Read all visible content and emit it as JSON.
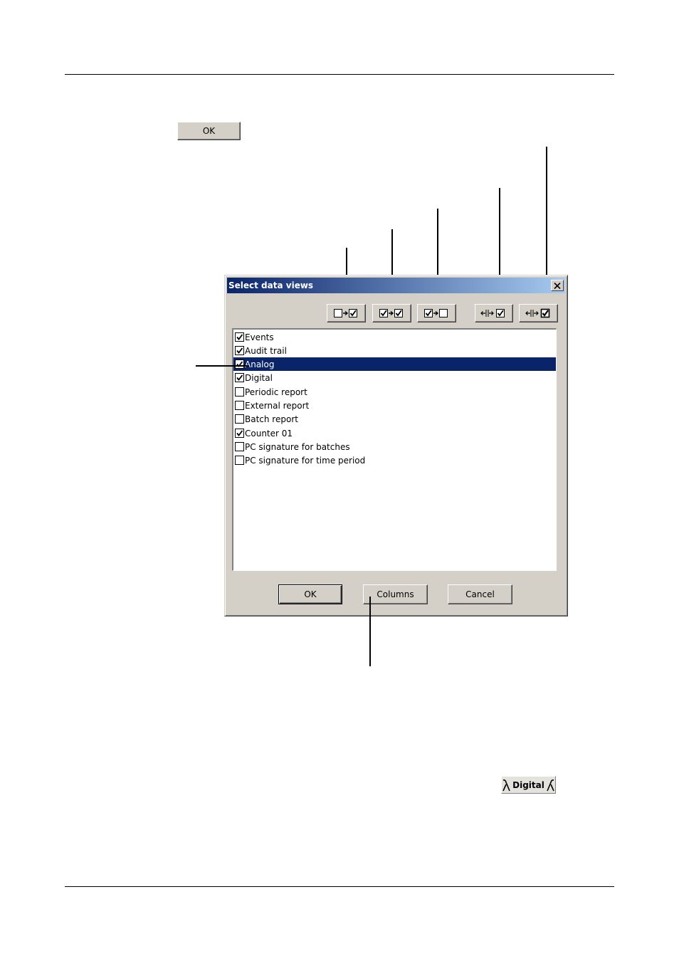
{
  "top_ok_button": {
    "label": "OK"
  },
  "dialog": {
    "title": "Select data views",
    "toolbar": [
      {
        "id": "none-to-checked",
        "icon": "unchecked-to-checked-icon"
      },
      {
        "id": "checked-to-checked",
        "icon": "checked-to-checked-icon"
      },
      {
        "id": "checked-to-unchecked",
        "icon": "checked-to-unchecked-icon"
      },
      {
        "id": "expand-checked",
        "icon": "expand-checked-icon"
      },
      {
        "id": "expand-checked-bold",
        "icon": "expand-checked-bold-icon"
      }
    ],
    "items": [
      {
        "label": "Events",
        "checked": true,
        "selected": false
      },
      {
        "label": "Audit trail",
        "checked": true,
        "selected": false
      },
      {
        "label": "Analog",
        "checked": true,
        "selected": true
      },
      {
        "label": "Digital",
        "checked": true,
        "selected": false
      },
      {
        "label": "Periodic report",
        "checked": false,
        "selected": false
      },
      {
        "label": "External report",
        "checked": false,
        "selected": false
      },
      {
        "label": "Batch report",
        "checked": false,
        "selected": false
      },
      {
        "label": "Counter 01",
        "checked": true,
        "selected": false
      },
      {
        "label": "PC signature for batches",
        "checked": false,
        "selected": false
      },
      {
        "label": "PC signature for time period",
        "checked": false,
        "selected": false
      }
    ],
    "buttons": {
      "ok": "OK",
      "columns": "Columns",
      "cancel": "Cancel"
    }
  },
  "digital_tab": {
    "label": "Digital"
  }
}
